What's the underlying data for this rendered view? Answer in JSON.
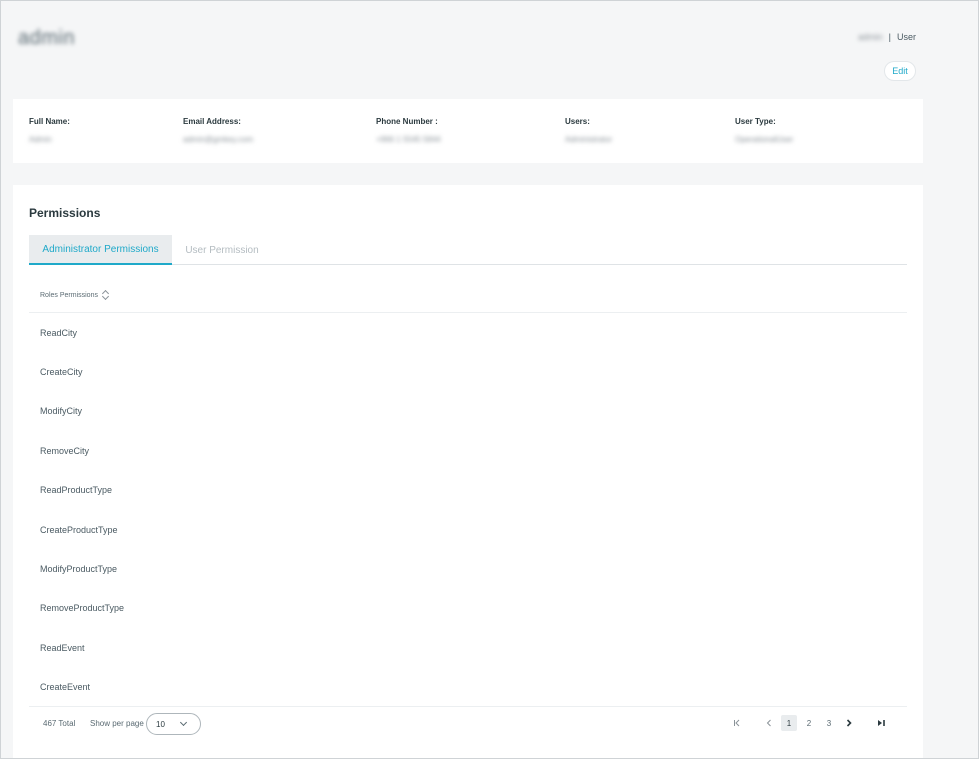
{
  "header": {
    "brand": "admin",
    "username": "admin",
    "separator": "|",
    "user_link": "User",
    "edit_label": "Edit"
  },
  "info": [
    {
      "label": "Full Name:",
      "value": "Admin"
    },
    {
      "label": "Email Address:",
      "value": "admin@gmkey.com"
    },
    {
      "label": "Phone Number :",
      "value": "+966 1 5545 5844"
    },
    {
      "label": "Users:",
      "value": "Administrator"
    },
    {
      "label": "User Type:",
      "value": "OperationalUser"
    }
  ],
  "permissions": {
    "title": "Permissions",
    "tabs": [
      {
        "label": "Administrator Permissions",
        "active": true
      },
      {
        "label": "User Permission",
        "active": false
      }
    ],
    "column_header": "Roles Permissions",
    "rows": [
      "ReadCity",
      "CreateCity",
      "ModifyCity",
      "RemoveCity",
      "ReadProductType",
      "CreateProductType",
      "ModifyProductType",
      "RemoveProductType",
      "ReadEvent",
      "CreateEvent"
    ]
  },
  "pagination": {
    "total": "467 Total",
    "per_page_label": "Show per page",
    "per_page_value": "10",
    "pages": [
      "1",
      "2",
      "3"
    ],
    "current_page": "1",
    "icons": [
      "first-page-icon",
      "prev-page-icon",
      "next-page-icon",
      "last-page-icon"
    ]
  },
  "colors": {
    "accent": "#1fa9c9",
    "background": "#f5f6f7",
    "card": "#ffffff",
    "text": "#2b3a3f"
  }
}
